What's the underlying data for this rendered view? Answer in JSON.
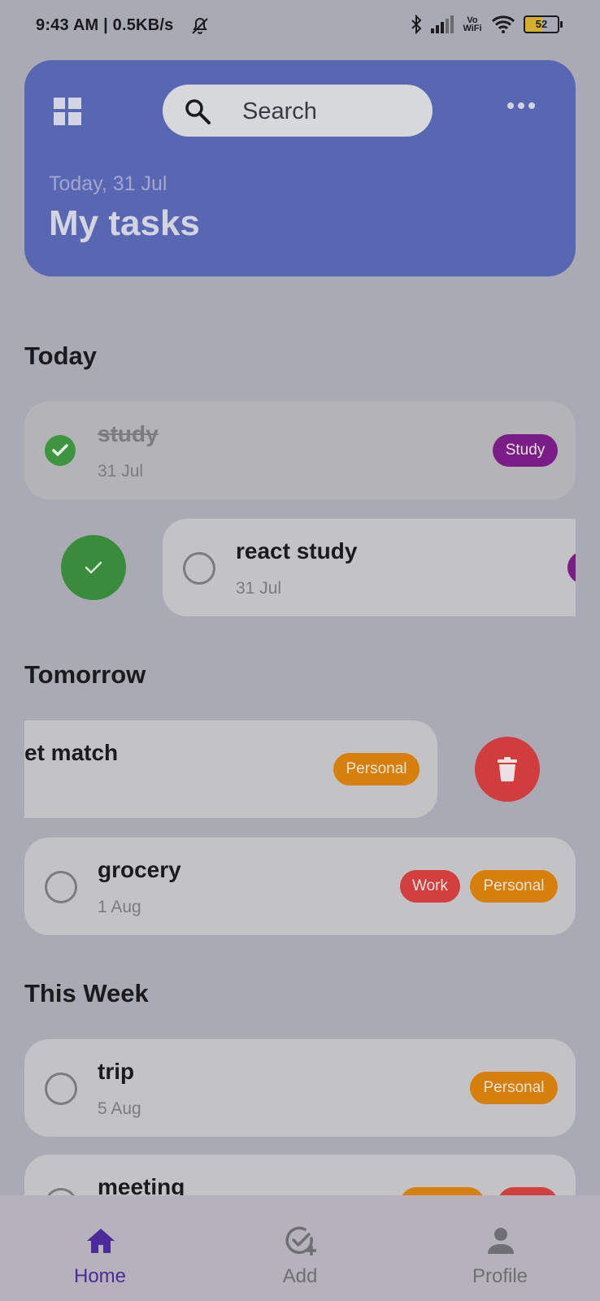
{
  "status_bar": {
    "time": "9:43 AM | 0.5KB/s",
    "vowifi": "Vo WiFi",
    "battery": "52"
  },
  "header": {
    "search_placeholder": "Search",
    "date": "Today, 31 Jul",
    "title": "My tasks"
  },
  "sections": {
    "today": "Today",
    "tomorrow": "Tomorrow",
    "this_week": "This Week"
  },
  "tasks": [
    {
      "title": "study",
      "date": "31 Jul",
      "completed": true,
      "tags": [
        "Study"
      ]
    },
    {
      "title": "react study",
      "date": "31 Jul",
      "completed": false,
      "tags": [
        "Study"
      ]
    },
    {
      "title": "et match",
      "date": "",
      "completed": false,
      "tags": [
        "Personal"
      ]
    },
    {
      "title": "grocery",
      "date": "1 Aug",
      "completed": false,
      "tags": [
        "Work",
        "Personal"
      ]
    },
    {
      "title": "trip",
      "date": "5 Aug",
      "completed": false,
      "tags": [
        "Personal"
      ]
    },
    {
      "title": "meeting",
      "date": "",
      "completed": false,
      "tags": [
        "Personal",
        "Work"
      ]
    }
  ],
  "bottom_nav": [
    {
      "label": "Home",
      "icon": "home-icon",
      "active": true
    },
    {
      "label": "Add",
      "icon": "add-task-icon",
      "active": false
    },
    {
      "label": "Profile",
      "icon": "profile-icon",
      "active": false
    }
  ],
  "colors": {
    "header": "#5967b3",
    "study_tag": "#7b1d86",
    "personal_tag": "#d67f0b",
    "work_tag": "#d33e3e",
    "complete_green": "#3d963f",
    "active_nav": "#4b2a9a"
  }
}
